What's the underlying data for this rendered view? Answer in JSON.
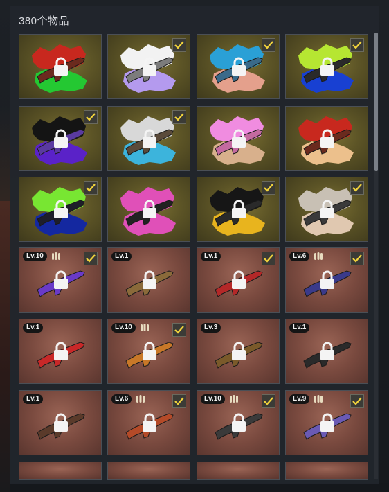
{
  "inventory": {
    "count_label": "380个物品"
  },
  "colors": {
    "check": "#f2d43c",
    "gold_bg": "#6b6230",
    "copper_bg": "#8a5548"
  },
  "tiles": [
    {
      "bg": "gold",
      "paint": [
        "#c8281e",
        "#24c832"
      ],
      "weapon": "#6b2a1e",
      "check": false,
      "level": "",
      "ammo": false
    },
    {
      "bg": "gold",
      "paint": [
        "#f2f2f2",
        "#b49aee"
      ],
      "weapon": "#7c7c7c",
      "check": true,
      "level": "",
      "ammo": false
    },
    {
      "bg": "gold",
      "paint": [
        "#2aa0d6",
        "#e4a08c"
      ],
      "weapon": "#3a6a8a",
      "check": true,
      "level": "",
      "ammo": false
    },
    {
      "bg": "gold",
      "paint": [
        "#b6e632",
        "#1840d2"
      ],
      "weapon": "#2a2a2a",
      "check": true,
      "level": "",
      "ammo": false
    },
    {
      "bg": "gold",
      "paint": [
        "#141414",
        "#5a22c8"
      ],
      "weapon": "#5a3aa0",
      "check": true,
      "level": "",
      "ammo": false
    },
    {
      "bg": "gold",
      "paint": [
        "#d8d8d8",
        "#3cb4dc"
      ],
      "weapon": "#5a4a3a",
      "check": true,
      "level": "",
      "ammo": false
    },
    {
      "bg": "gold",
      "paint": [
        "#f08ce0",
        "#d8b08c"
      ],
      "weapon": "#c46aa0",
      "check": false,
      "level": "",
      "ammo": false
    },
    {
      "bg": "gold",
      "paint": [
        "#c8281e",
        "#ecc08c"
      ],
      "weapon": "#6a2a1e",
      "check": false,
      "level": "",
      "ammo": false
    },
    {
      "bg": "gold",
      "paint": [
        "#78e632",
        "#1428a0"
      ],
      "weapon": "#1e1e2a",
      "check": true,
      "level": "",
      "ammo": false
    },
    {
      "bg": "gold",
      "paint": [
        "#e050b8",
        "#e050b8"
      ],
      "weapon": "#222222",
      "check": false,
      "level": "",
      "ammo": false
    },
    {
      "bg": "gold",
      "paint": [
        "#161616",
        "#e8b41e"
      ],
      "weapon": "#2a2a2a",
      "check": true,
      "level": "",
      "ammo": false
    },
    {
      "bg": "gold",
      "paint": [
        "#c8c0b4",
        "#e0c8b0"
      ],
      "weapon": "#3a3a3a",
      "check": true,
      "level": "",
      "ammo": false
    },
    {
      "bg": "copper",
      "paint": [],
      "weapon": "#6a3ac8",
      "check": true,
      "level": "Lv.10",
      "ammo": true
    },
    {
      "bg": "copper",
      "paint": [],
      "weapon": "#8a6a3a",
      "check": false,
      "level": "Lv.1",
      "ammo": false
    },
    {
      "bg": "copper",
      "paint": [],
      "weapon": "#b42828",
      "check": true,
      "level": "Lv.1",
      "ammo": false
    },
    {
      "bg": "copper",
      "paint": [],
      "weapon": "#3a3a8a",
      "check": true,
      "level": "Lv.6",
      "ammo": true
    },
    {
      "bg": "copper",
      "paint": [],
      "weapon": "#c82828",
      "check": false,
      "level": "Lv.1",
      "ammo": false
    },
    {
      "bg": "copper",
      "paint": [],
      "weapon": "#c87828",
      "check": true,
      "level": "Lv.10",
      "ammo": true
    },
    {
      "bg": "copper",
      "paint": [],
      "weapon": "#7a5a2a",
      "check": false,
      "level": "Lv.3",
      "ammo": false
    },
    {
      "bg": "copper",
      "paint": [],
      "weapon": "#2a2a2a",
      "check": false,
      "level": "Lv.1",
      "ammo": false
    },
    {
      "bg": "copper",
      "paint": [],
      "weapon": "#5a3a2a",
      "check": false,
      "level": "Lv.1",
      "ammo": false
    },
    {
      "bg": "copper",
      "paint": [],
      "weapon": "#b44a28",
      "check": true,
      "level": "Lv.6",
      "ammo": true
    },
    {
      "bg": "copper",
      "paint": [],
      "weapon": "#3a3a3a",
      "check": true,
      "level": "Lv.10",
      "ammo": true
    },
    {
      "bg": "copper",
      "paint": [],
      "weapon": "#6a5ab4",
      "check": true,
      "level": "Lv.9",
      "ammo": true
    }
  ]
}
